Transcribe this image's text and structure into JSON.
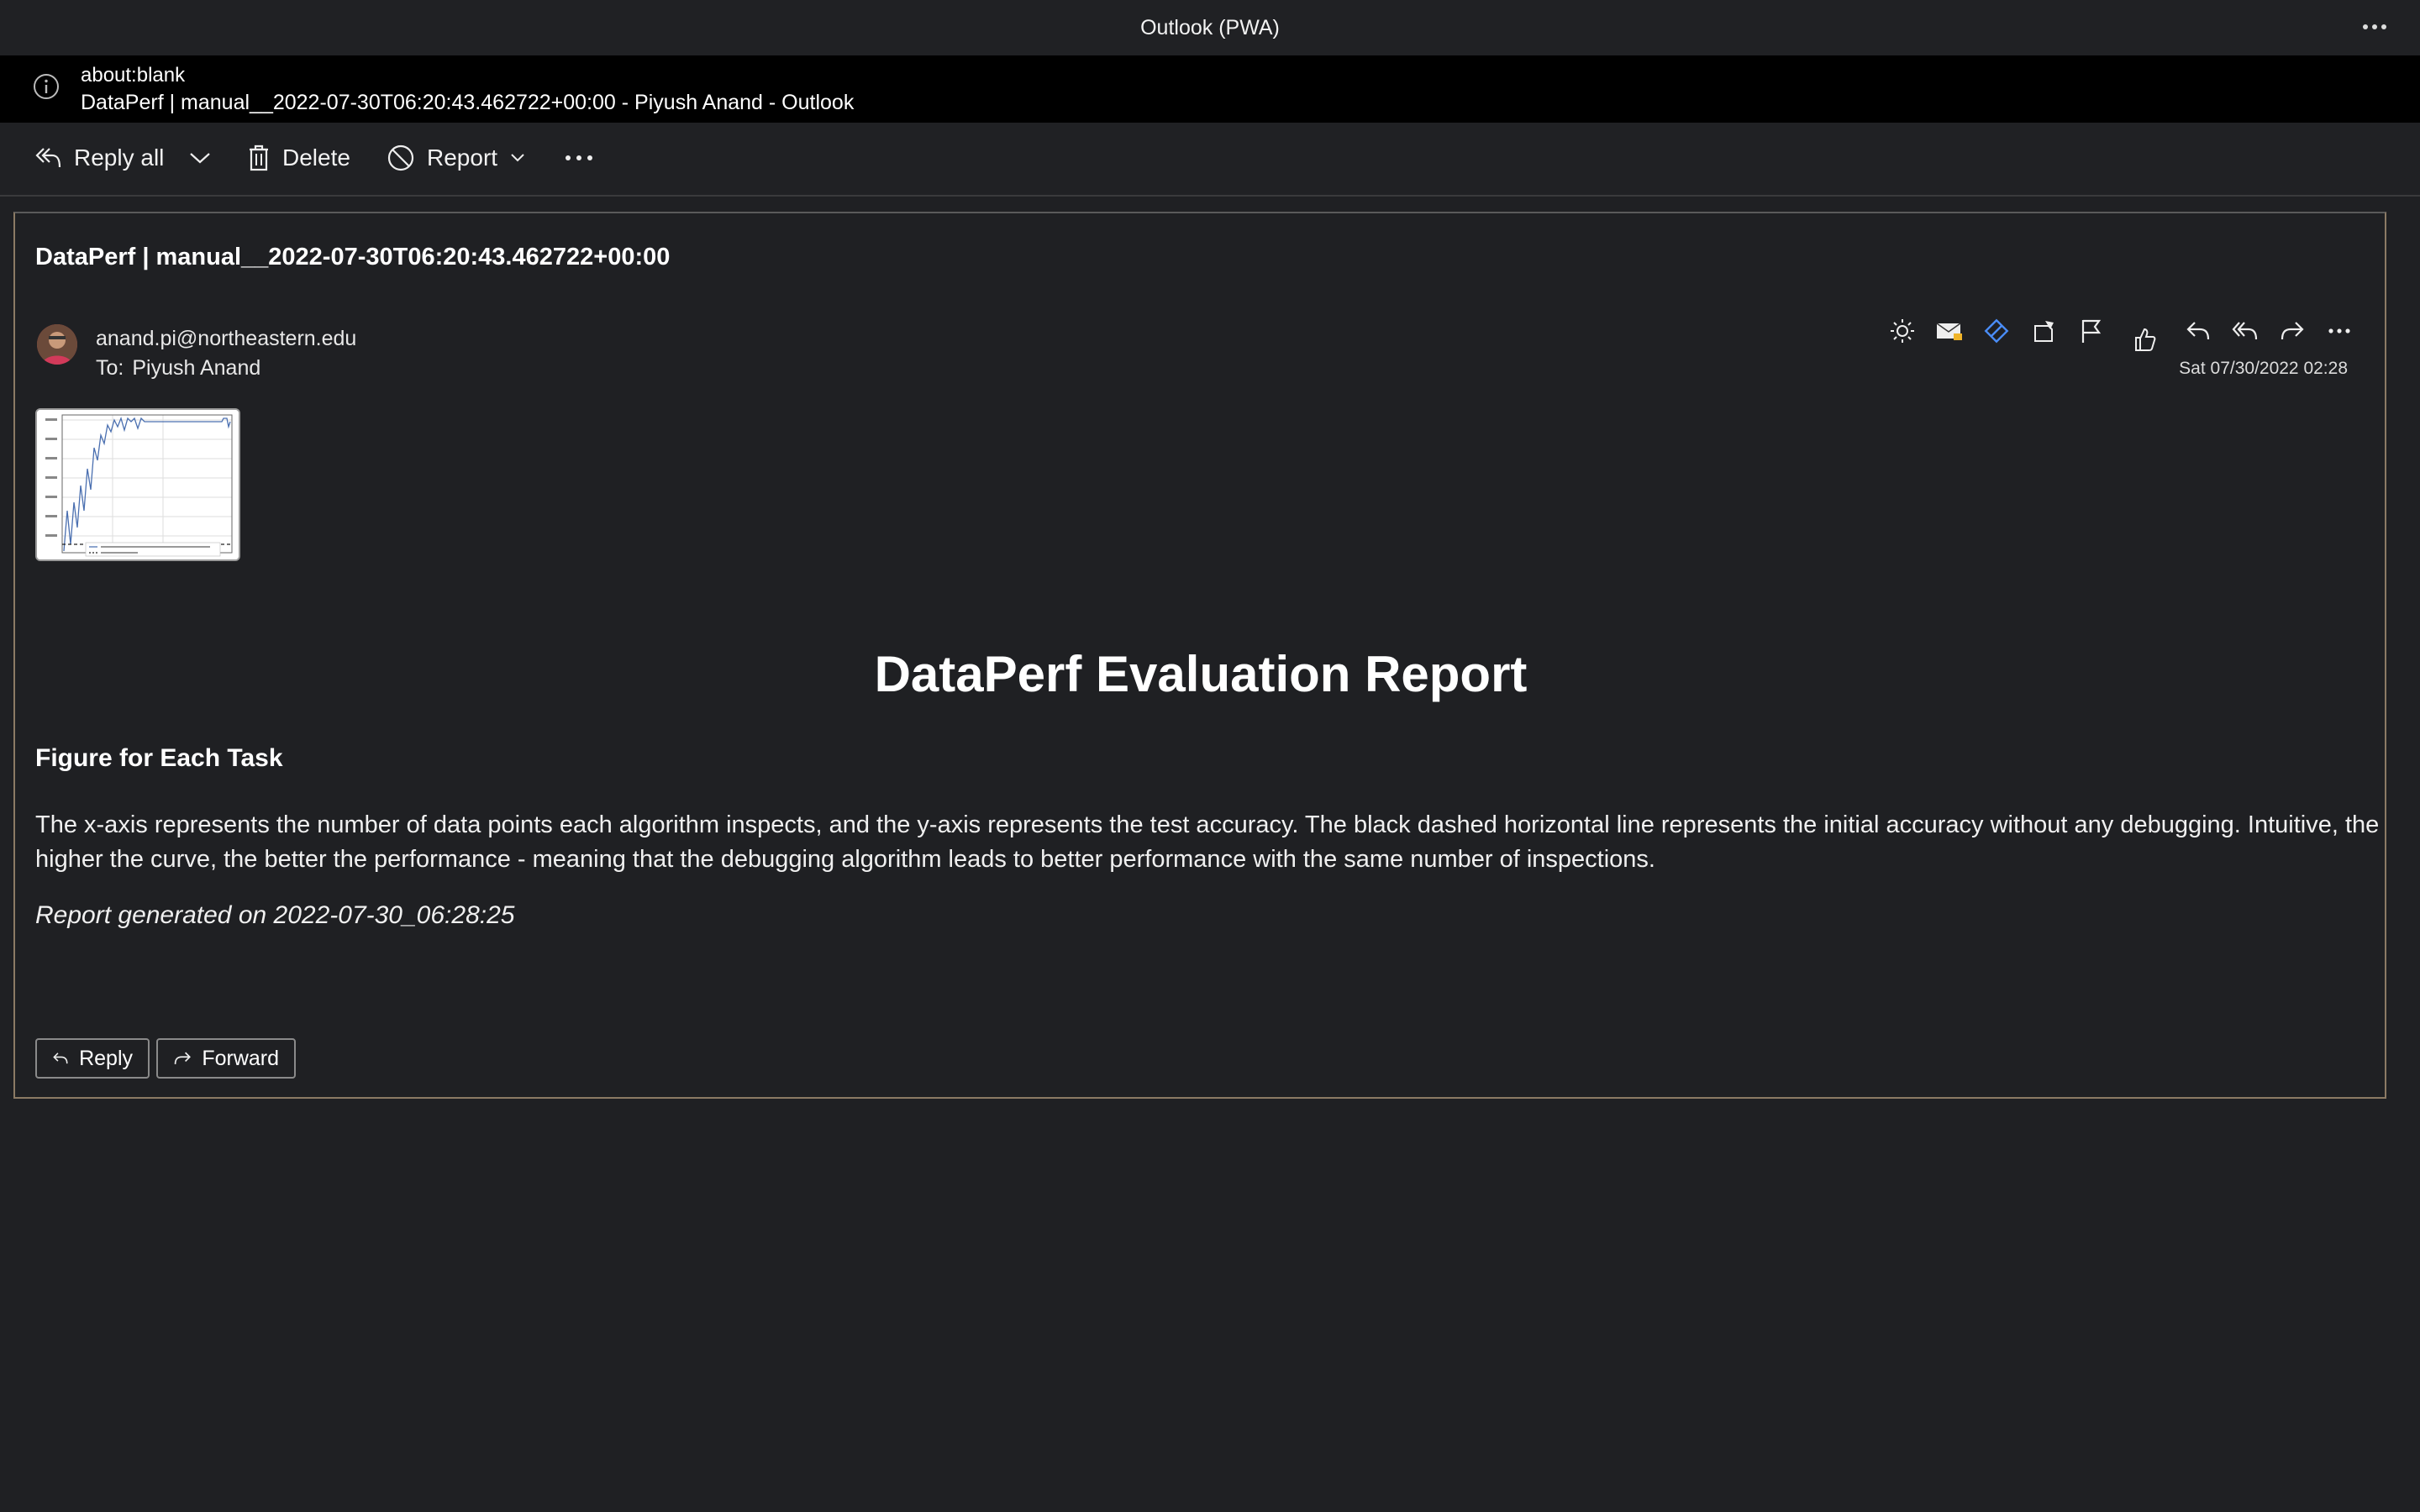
{
  "window": {
    "title": "Outlook (PWA)"
  },
  "urlbar": {
    "url": "about:blank",
    "page_title": "DataPerf | manual__2022-07-30T06:20:43.462722+00:00 - Piyush Anand - Outlook"
  },
  "toolbar": {
    "reply_all_label": "Reply all",
    "delete_label": "Delete",
    "report_label": "Report"
  },
  "message": {
    "subject": "DataPerf | manual__2022-07-30T06:20:43.462722+00:00",
    "sender": "anand.pi@northeastern.edu",
    "to_label": "To:",
    "to_name": "Piyush Anand",
    "date": "Sat 07/30/2022 02:28",
    "action_icons": [
      "sun-icon",
      "mail-tag-icon",
      "link-icon",
      "sticky-note-icon",
      "flag-icon",
      "like-icon",
      "reply-icon",
      "reply-all-icon",
      "forward-icon",
      "more-icon"
    ]
  },
  "body": {
    "title": "DataPerf Evaluation Report",
    "section_title": "Figure for Each Task",
    "paragraph": "The x-axis represents the number of data points each algorithm inspects, and the y-axis represents the test accuracy. The black dashed horizontal line represents the initial accuracy without any debugging. Intuitive, the higher the curve, the better the performance - meaning that the debugging algorithm leads to better performance with the same number of inspections.",
    "generated": "Report generated on 2022-07-30_06:28:25"
  },
  "footer_buttons": {
    "reply_label": "Reply",
    "forward_label": "Forward"
  },
  "colors": {
    "background": "#1f2023",
    "urlbar": "#000000",
    "link_accent": "#4a8df8",
    "card_border": "#8b7a64"
  }
}
